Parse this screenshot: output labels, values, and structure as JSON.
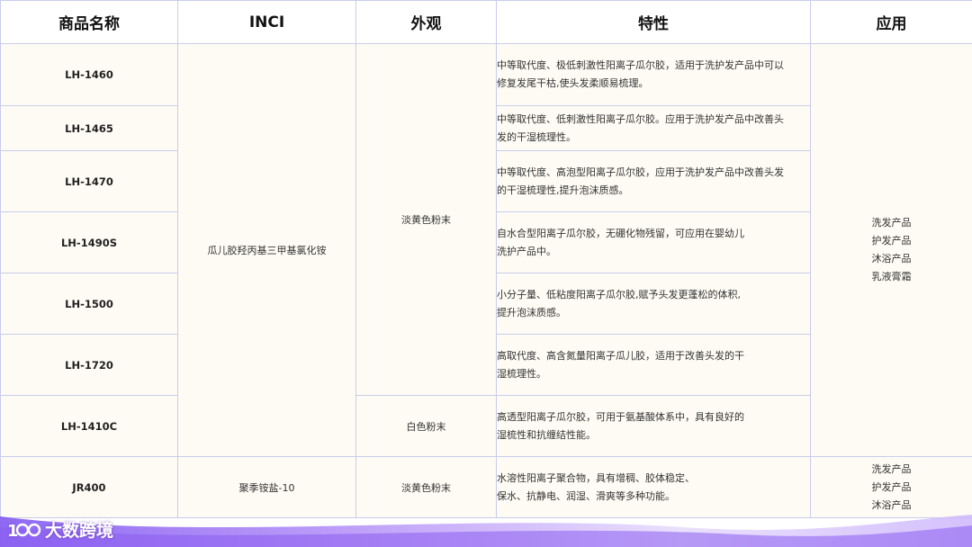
{
  "headers": [
    "商品名称",
    "INCI",
    "外观",
    "特性",
    "应用"
  ],
  "rows": [
    {
      "name": "LH-1460",
      "feature": [
        "中等取代度、极低刺激性阳离子瓜尔胶，适用于洗护发产品中可以",
        "修复发尾干枯,使头发柔顺易梳理。"
      ]
    },
    {
      "name": "LH-1465",
      "feature": [
        "中等取代度、低刺激性阳离子瓜尔胶。应用于洗护发产品中改善头",
        "发的干湿梳理性。"
      ]
    },
    {
      "name": "LH-1470",
      "feature": [
        "中等取代度、高泡型阳离子瓜尔胶，应用于洗护发产品中改善头发",
        "的干湿梳理性,提升泡沫质感。"
      ]
    },
    {
      "name": "LH-1490S",
      "feature": [
        "自水合型阳离子瓜尔胶，无硼化物残留，可应用在婴幼儿",
        "洗护产品中。"
      ]
    },
    {
      "name": "LH-1500",
      "feature": [
        "小分子量、低粘度阳离子瓜尔胶,赋予头发更蓬松的体积,",
        "提升泡沫质感。"
      ]
    },
    {
      "name": "LH-1720",
      "feature": [
        "高取代度、高含氮量阳离子瓜儿胶，适用于改善头发的干",
        "湿梳理性。"
      ]
    },
    {
      "name": "LH-1410C",
      "feature": [
        "高透型阳离子瓜尔胶，可用于氨基酸体系中，具有良好的",
        "湿梳性和抗缠结性能。"
      ]
    },
    {
      "name": "JR400",
      "feature": [
        "水溶性阳离子聚合物，具有增稠、胶体稳定、",
        "保水、抗静电、润湿、滑爽等多种功能。"
      ]
    }
  ],
  "guar_inci": "瓜儿胶羟丙基三甲基氯化铵",
  "jr400_inci": "聚季铵盐-10",
  "appearance": {
    "light_yellow_powder": "淡黄色粉末",
    "white_powder": "白色粉末",
    "jr400": "淡黄色粉末"
  },
  "applications_main": [
    "洗发产品",
    "护发产品",
    "沐浴产品",
    "乳液膏霜"
  ],
  "applications_jr400": [
    "洗发产品",
    "护发产品",
    "沐浴产品"
  ],
  "brand": "大数跨境",
  "colors": {
    "border": "#c9cdea",
    "cell_bg": "#fdfbf3",
    "wave": "#8a5cf0"
  }
}
